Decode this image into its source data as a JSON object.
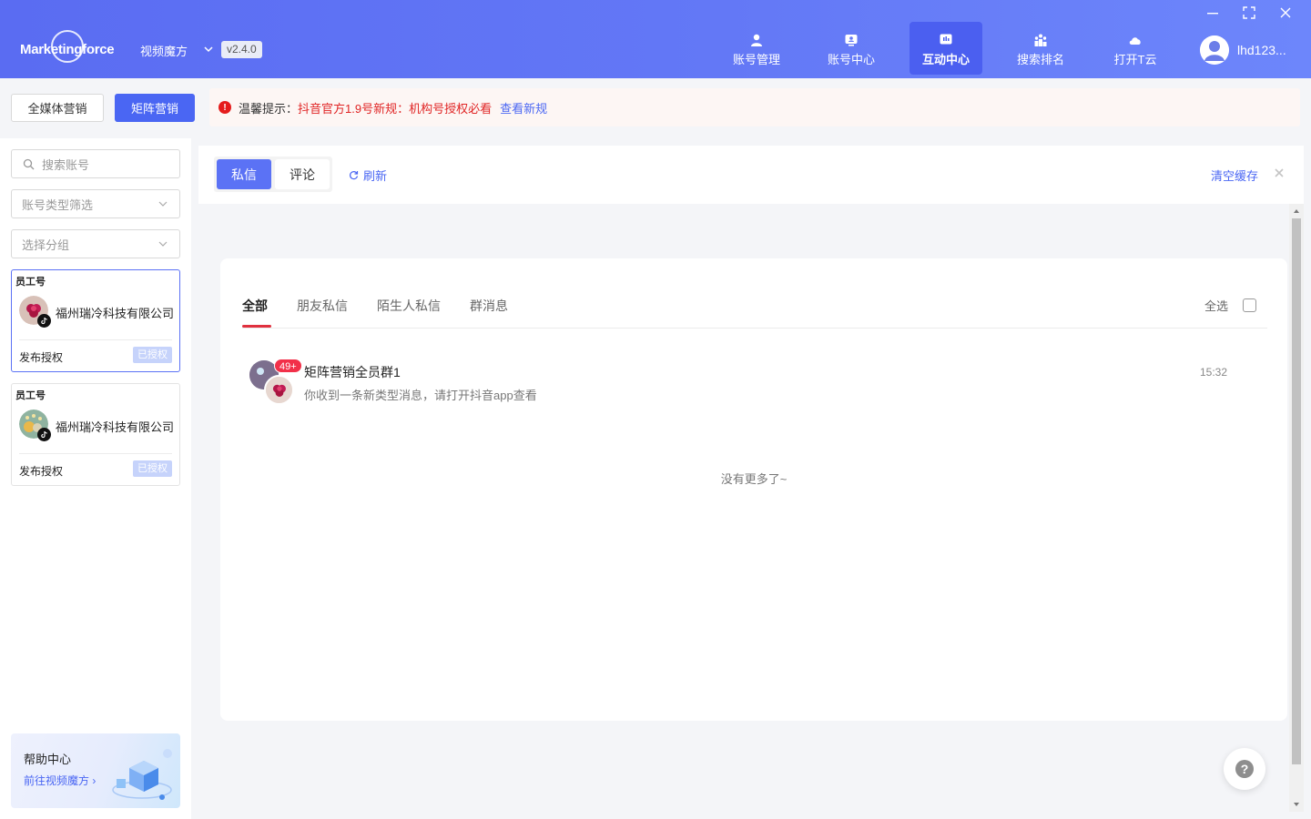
{
  "header": {
    "logo_text": "Marketingforce",
    "app_name": "视频魔方",
    "version": "v2.4.0",
    "nav": [
      {
        "label": "账号管理",
        "icon": "user-icon",
        "active": false
      },
      {
        "label": "账号中心",
        "icon": "account-center-icon",
        "active": false
      },
      {
        "label": "互动中心",
        "icon": "chat-icon",
        "active": true
      },
      {
        "label": "搜索排名",
        "icon": "ranking-icon",
        "active": false
      },
      {
        "label": "打开T云",
        "icon": "cloud-icon",
        "active": false
      }
    ],
    "user_name": "lhd123..."
  },
  "subheader": {
    "all_media_label": "全媒体营销",
    "matrix_label": "矩阵营销",
    "notice_label": "温馨提示：",
    "notice_text": "抖音官方1.9号新规：机构号授权必看",
    "notice_link": "查看新规"
  },
  "sidebar": {
    "search_placeholder": "搜索账号",
    "type_filter": "账号类型筛选",
    "group_select": "选择分组",
    "accounts": [
      {
        "tag": "员工号",
        "name": "福州瑞冷科技有限公司",
        "auth_label": "发布授权",
        "status": "已授权",
        "selected": true
      },
      {
        "tag": "员工号",
        "name": "福州瑞冷科技有限公司",
        "auth_label": "发布授权",
        "status": "已授权",
        "selected": false
      }
    ],
    "help": {
      "title": "帮助中心",
      "link": "前往视频魔方"
    }
  },
  "main": {
    "segments": [
      "私信",
      "评论"
    ],
    "refresh_label": "刷新",
    "clear_cache_label": "清空缓存",
    "tabs": [
      "全部",
      "朋友私信",
      "陌生人私信",
      "群消息"
    ],
    "select_all_label": "全选",
    "messages": [
      {
        "title": "矩阵营销全员群1",
        "preview": "你收到一条新类型消息，请打开抖音app查看",
        "time": "15:32",
        "badge": "49+"
      }
    ],
    "no_more_text": "没有更多了~"
  },
  "colors": {
    "brand": "#5a6cf2",
    "accent": "#4a66f3",
    "alert": "#e02424",
    "badge": "#f23049"
  }
}
